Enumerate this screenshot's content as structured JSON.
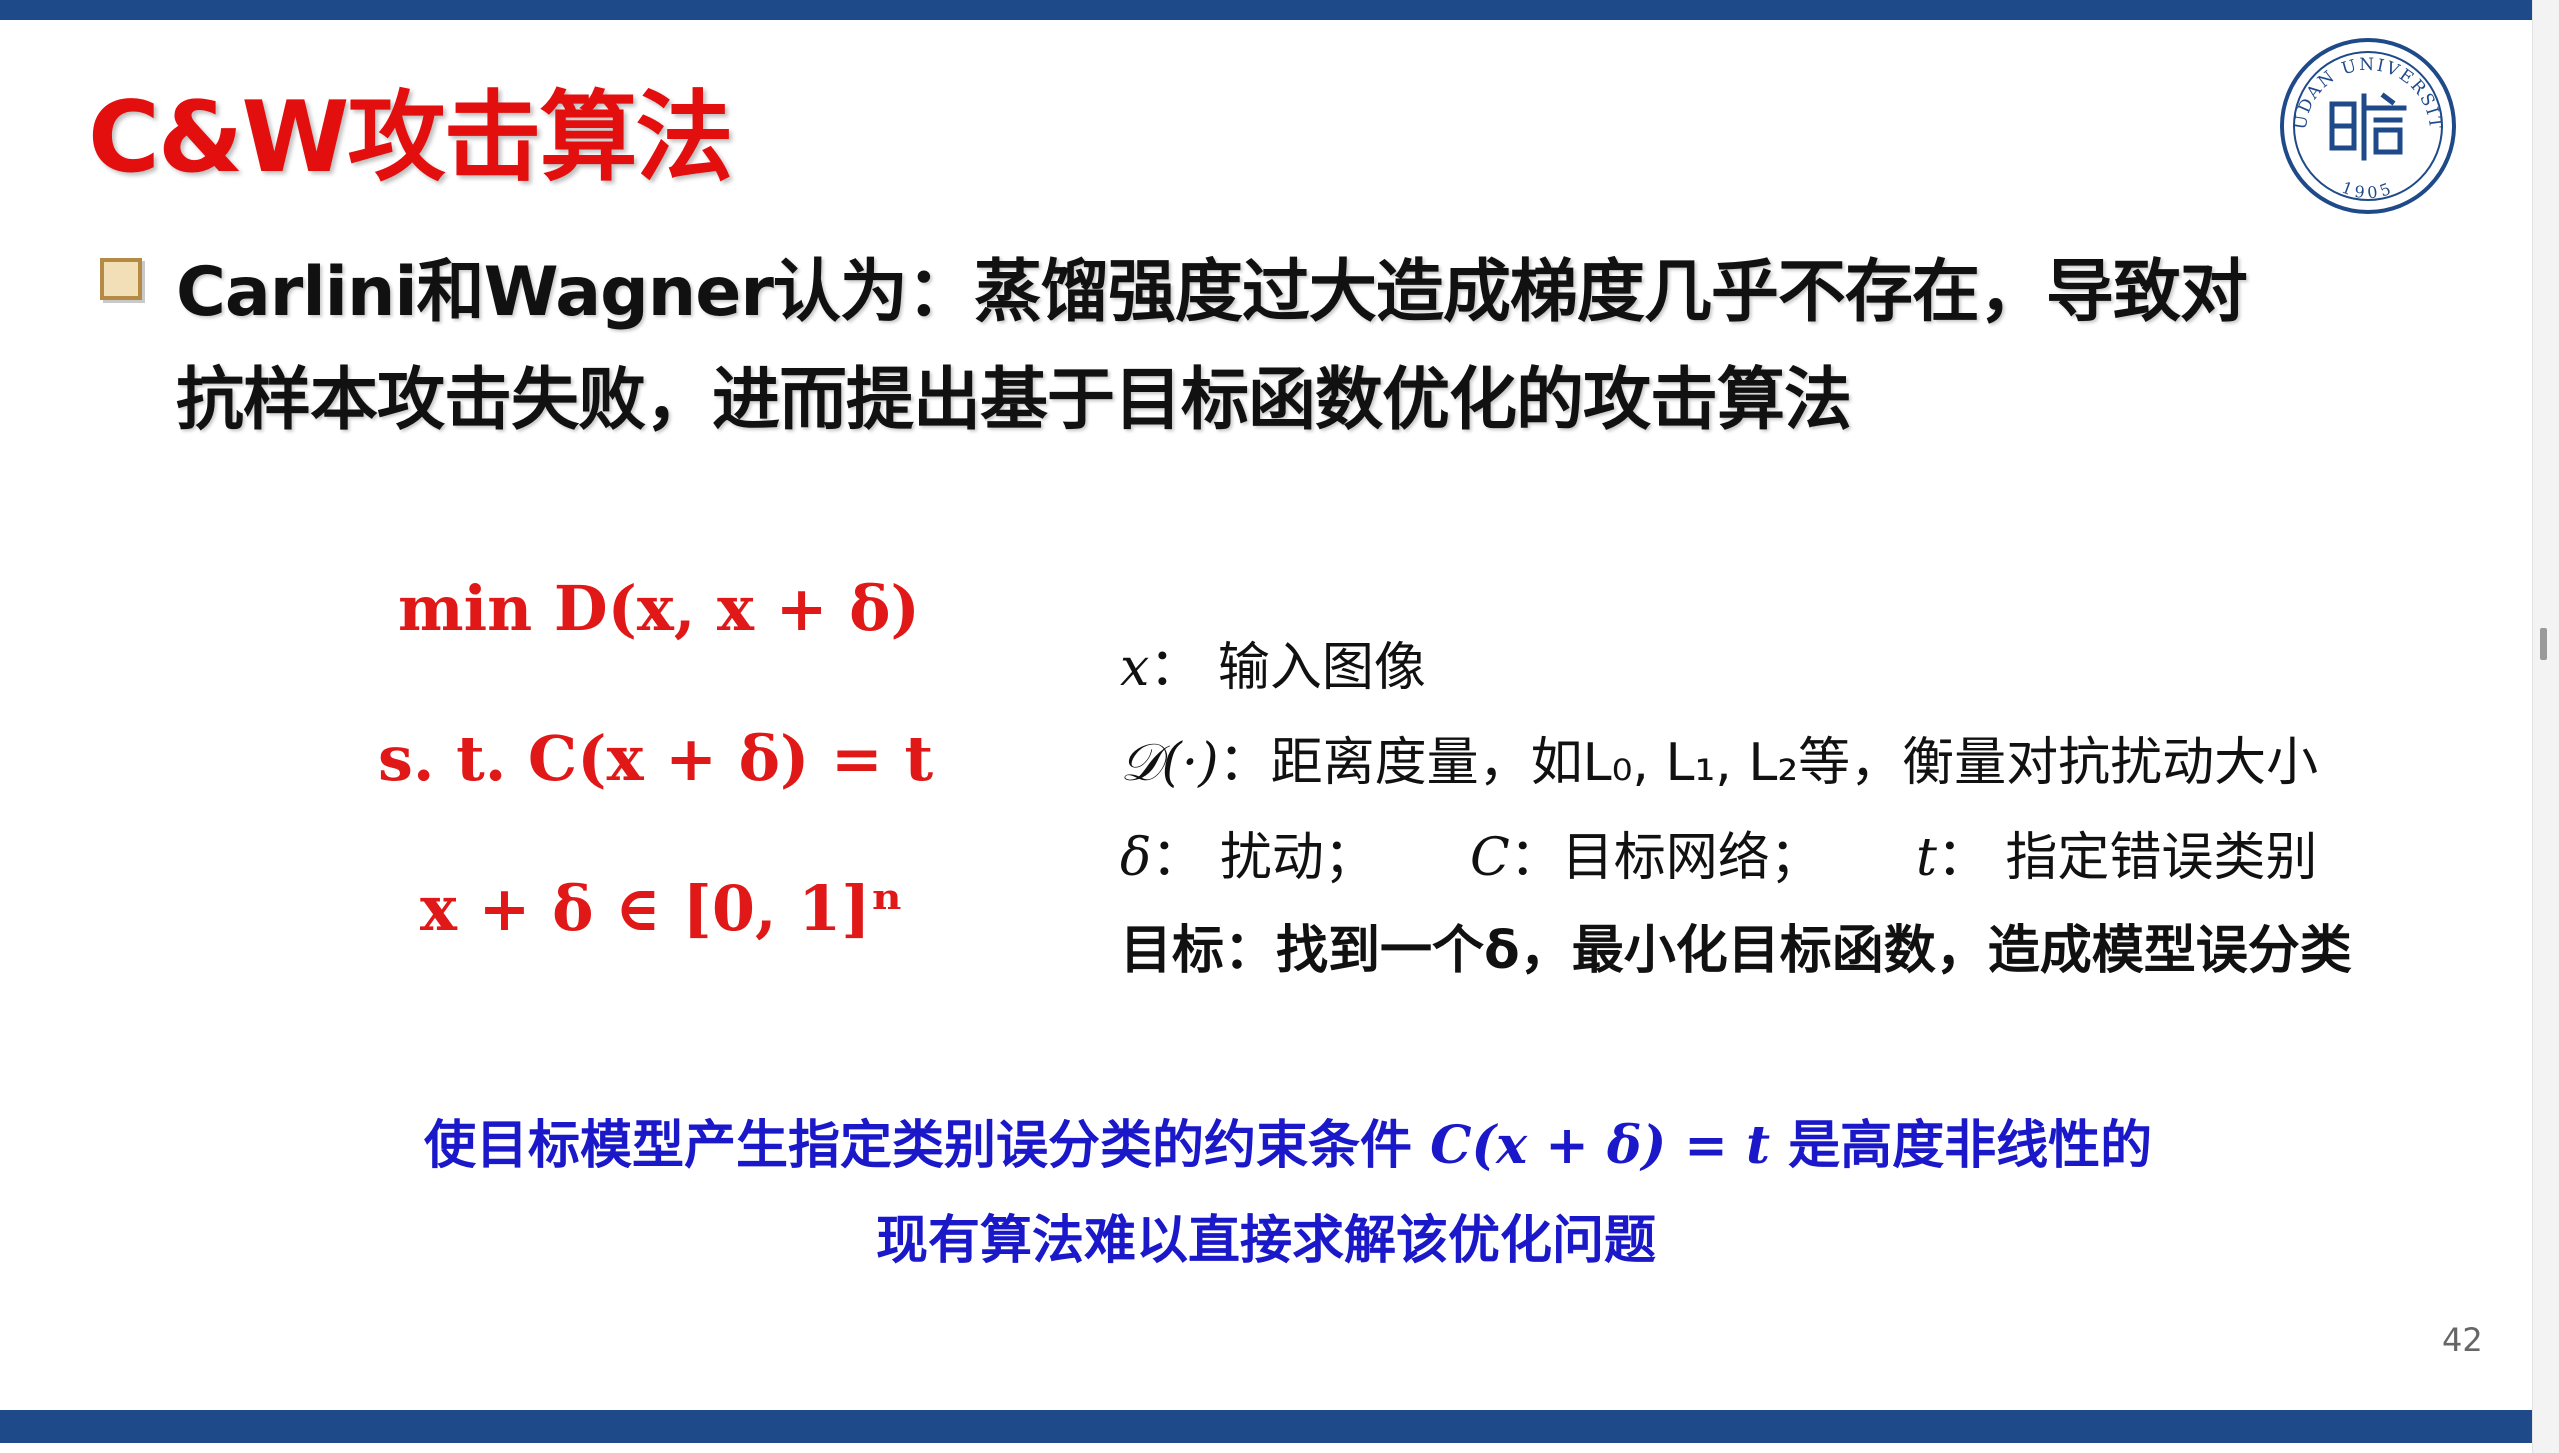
{
  "slide": {
    "title": "C&W攻击算法",
    "bullet": {
      "line1": "Carlini和Wagner认为：蒸馏强度过大造成梯度几乎不存在，导致对",
      "line2": "抗样本攻击失败，进而提出基于目标函数优化的攻击算法"
    },
    "formulas": {
      "line1": "min D(x, x + δ)",
      "line2": "s. t.  C(x + δ) = t",
      "line3": "x + δ ∈ [0, 1]ⁿ"
    },
    "definitions": {
      "x_symbol": "x",
      "x_text": "： 输入图像",
      "d_symbol": "𝒟(·)",
      "d_text": "：距离度量，如L₀, L₁, L₂等，衡量对抗扰动大小",
      "delta_symbol": "δ",
      "delta_text": "： 扰动；",
      "c_symbol": "C",
      "c_text": "：目标网络；",
      "t_symbol": "t",
      "t_text": "： 指定错误类别",
      "goal": "目标：找到一个δ，最小化目标函数，造成模型误分类"
    },
    "note": {
      "line1_pre": "使目标模型产生指定类别误分类的约束条件 ",
      "line1_formula": "C(x + δ) = t",
      "line1_post": " 是高度非线性的",
      "line2": "现有算法难以直接求解该优化问题"
    },
    "page_number": "42",
    "logo": {
      "text": "FUDAN UNIVERSITY",
      "year": "1905"
    },
    "colors": {
      "title": "#e30e0e",
      "formula": "#e01818",
      "note": "#1a18c8",
      "bar": "#1f4a8a",
      "logo": "#1f4a8a"
    }
  }
}
